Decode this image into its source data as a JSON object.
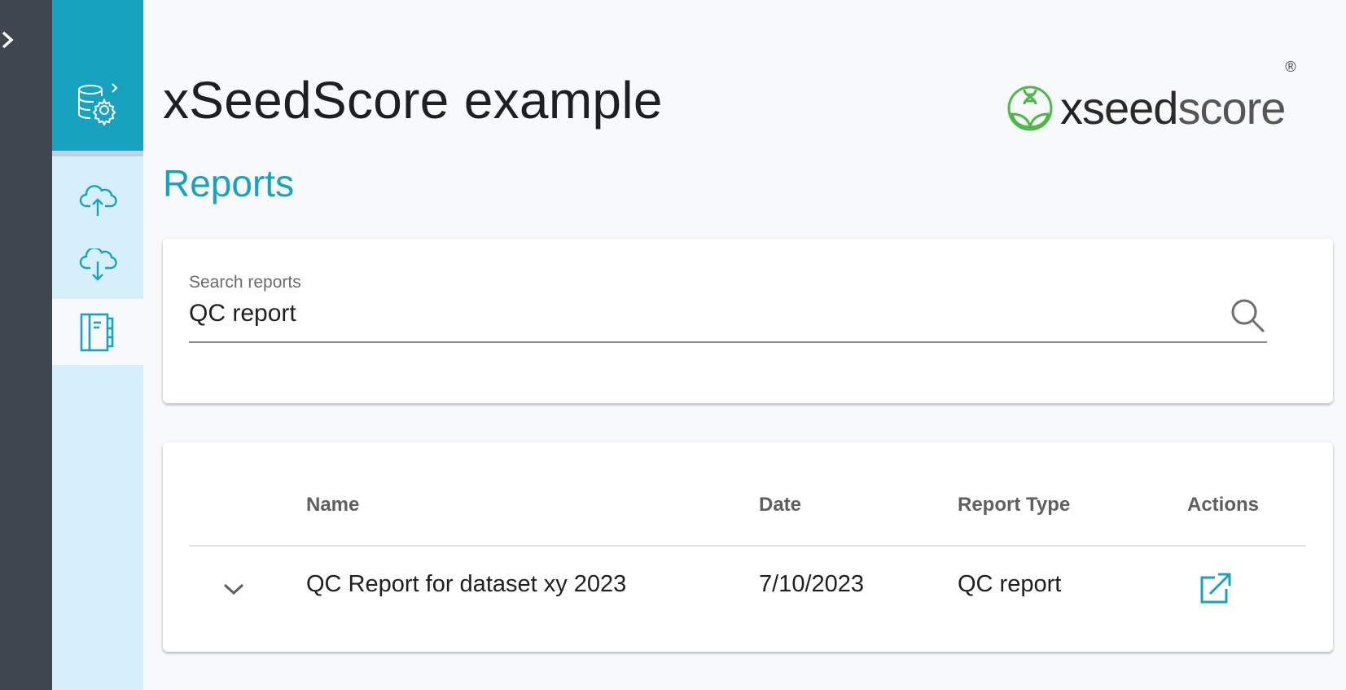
{
  "app": {
    "title": "xSeedScore example",
    "section": "Reports",
    "brand_color": "#17a3c0",
    "logo": {
      "x": "x",
      "seed": "seed",
      "score": "score",
      "reg": "®",
      "icon": "leaf-dna-icon",
      "icon_color": "#4cb848"
    }
  },
  "sidebar": {
    "toggle_icon": "chevron-right-icon",
    "header_icon": "database-settings-icon",
    "items": [
      {
        "name": "upload",
        "icon": "cloud-upload-icon",
        "active": false
      },
      {
        "name": "download",
        "icon": "cloud-download-icon",
        "active": false
      },
      {
        "name": "reports",
        "icon": "notebook-icon",
        "active": true
      }
    ]
  },
  "search": {
    "label": "Search reports",
    "value": "QC report",
    "icon": "search-icon"
  },
  "table": {
    "columns": [
      "Name",
      "Date",
      "Report Type",
      "Actions"
    ],
    "rows": [
      {
        "name": "QC Report for dataset xy 2023",
        "date": "7/10/2023",
        "type": "QC report",
        "action_icon": "open-external-icon"
      }
    ]
  }
}
